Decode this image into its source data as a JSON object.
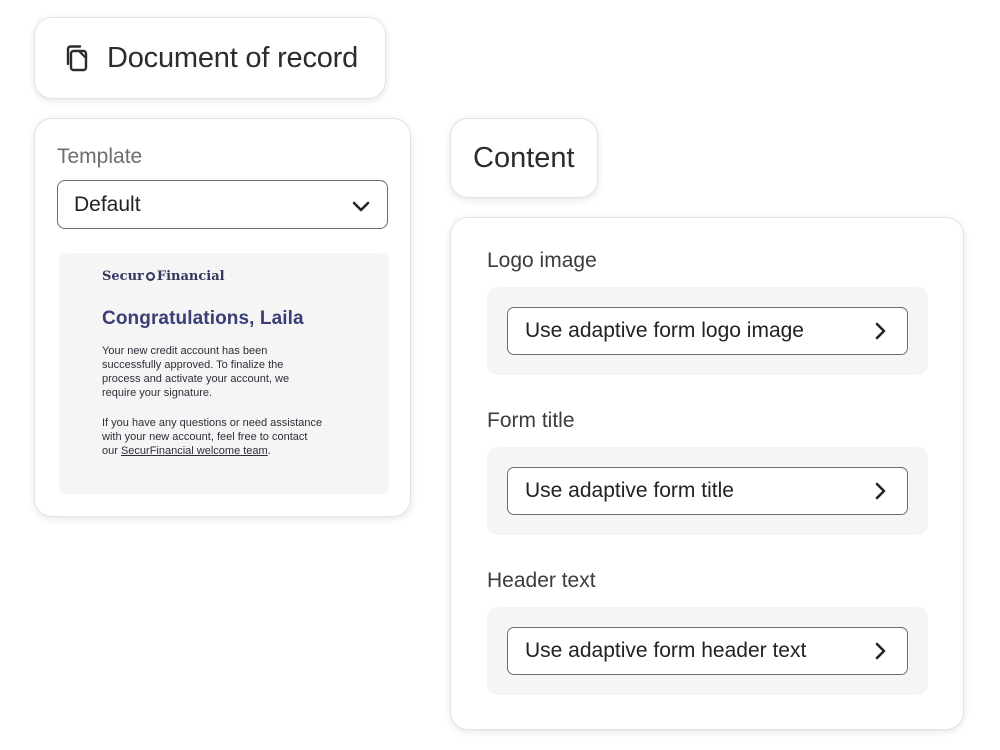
{
  "doc_record": {
    "icon": "copy-icon",
    "title": "Document of record"
  },
  "template": {
    "label": "Template",
    "selected": "Default"
  },
  "preview": {
    "logo_left": "Secur",
    "logo_right": "Financial",
    "heading": "Congratulations, Laila",
    "para1": "Your new credit account has been successfully approved. To finalize the process and activate your account, we require your signature.",
    "para2_prefix": "If you have any questions or need assistance with your new account, feel free to contact our ",
    "para2_link": "SecurFinancial welcome team",
    "para2_suffix": "."
  },
  "content": {
    "tab_label": "Content",
    "fields": [
      {
        "label": "Logo image",
        "value": "Use adaptive form logo image"
      },
      {
        "label": "Form title",
        "value": "Use adaptive form title"
      },
      {
        "label": "Header text",
        "value": "Use adaptive form header text"
      }
    ]
  },
  "colors": {
    "brand_navy": "#3b3d76",
    "border": "#6d6d6d",
    "panel_bg": "#f5f5f5"
  }
}
